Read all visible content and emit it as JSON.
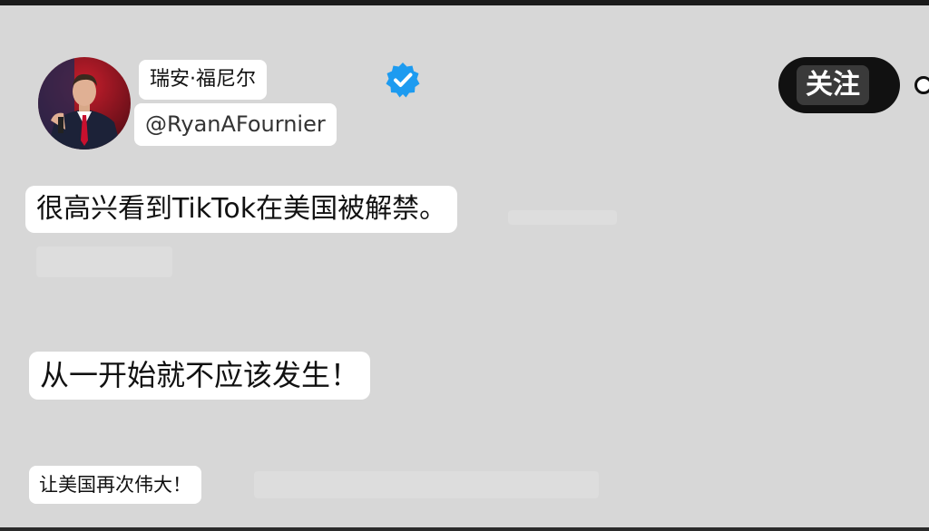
{
  "profile": {
    "display_name": "瑞安·福尼尔",
    "handle": "@RyanAFournier",
    "verified_icon": "verified-badge-icon",
    "avatar_icon": "profile-avatar"
  },
  "actions": {
    "follow_label": "关注",
    "more_icon": "more-options-icon"
  },
  "post": {
    "line1": "很高兴看到TikTok在美国被解禁。",
    "line2": "从一开始就不应该发生！",
    "line3": "让美国再次伟大！"
  },
  "colors": {
    "background": "#d7d7d7",
    "verified_blue": "#1d9bf0",
    "follow_bg": "#111111"
  }
}
